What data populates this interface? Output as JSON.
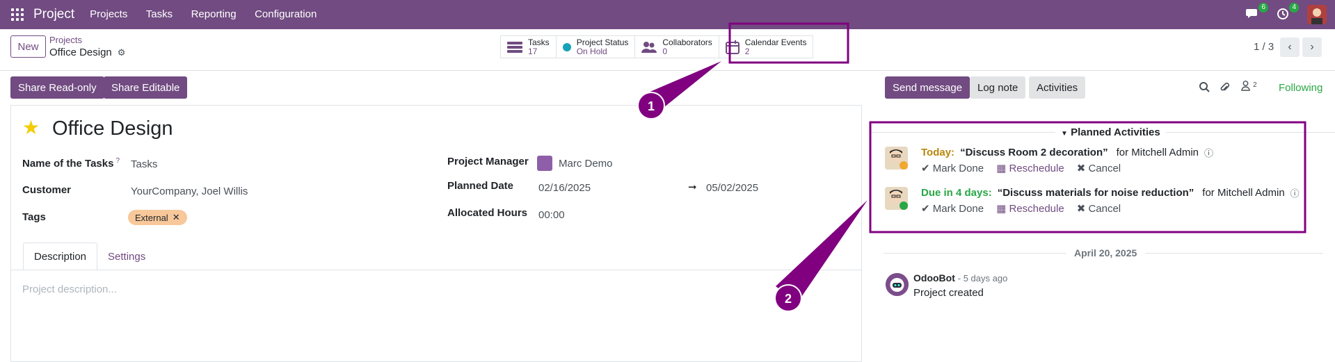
{
  "topbar": {
    "brand": "Project",
    "nav": [
      "Projects",
      "Tasks",
      "Reporting",
      "Configuration"
    ],
    "messages_count": "6",
    "activities_count": "4"
  },
  "control": {
    "new_label": "New",
    "breadcrumb_parent": "Projects",
    "breadcrumb_current": "Office Design",
    "smart_buttons": [
      {
        "label": "Tasks",
        "value": "17",
        "icon": "tasks-icon"
      },
      {
        "label": "Project Status",
        "value": "On Hold",
        "icon": "status-dot-icon"
      },
      {
        "label": "Collaborators",
        "value": "0",
        "icon": "users-icon"
      },
      {
        "label": "Calendar Events",
        "value": "2",
        "icon": "calendar-icon"
      }
    ],
    "pager": "1 / 3"
  },
  "actions": {
    "share_readonly": "Share Read-only",
    "share_editable": "Share Editable"
  },
  "form": {
    "title": "Office Design",
    "name_of_tasks_label": "Name of the Tasks",
    "name_of_tasks_help": "?",
    "name_of_tasks": "Tasks",
    "customer_label": "Customer",
    "customer": "YourCompany, Joel Willis",
    "tags_label": "Tags",
    "tag": "External",
    "project_manager_label": "Project Manager",
    "project_manager": "Marc Demo",
    "planned_date_label": "Planned Date",
    "planned_start": "02/16/2025",
    "planned_end": "05/02/2025",
    "allocated_hours_label": "Allocated Hours",
    "allocated_hours": "00:00",
    "tabs": [
      "Description",
      "Settings"
    ],
    "description_placeholder": "Project description..."
  },
  "chatter": {
    "send_message": "Send message",
    "log_note": "Log note",
    "activities": "Activities",
    "followers_count": "2",
    "following": "Following",
    "planned_header": "Planned Activities",
    "activities_list": [
      {
        "when": "Today:",
        "summary": "“Discuss Room 2 decoration”",
        "assignee": "for Mitchell Admin",
        "when_color": "#B8860B"
      },
      {
        "when": "Due in 4 days:",
        "summary": "“Discuss materials for noise reduction”",
        "assignee": "for Mitchell Admin",
        "when_color": "#28A745"
      }
    ],
    "mark_done": "Mark Done",
    "reschedule": "Reschedule",
    "cancel": "Cancel",
    "date_separator": "April 20, 2025",
    "message_author": "OdooBot",
    "message_time": "- 5 days ago",
    "message_body": "Project created"
  },
  "callouts": [
    "1",
    "2"
  ]
}
